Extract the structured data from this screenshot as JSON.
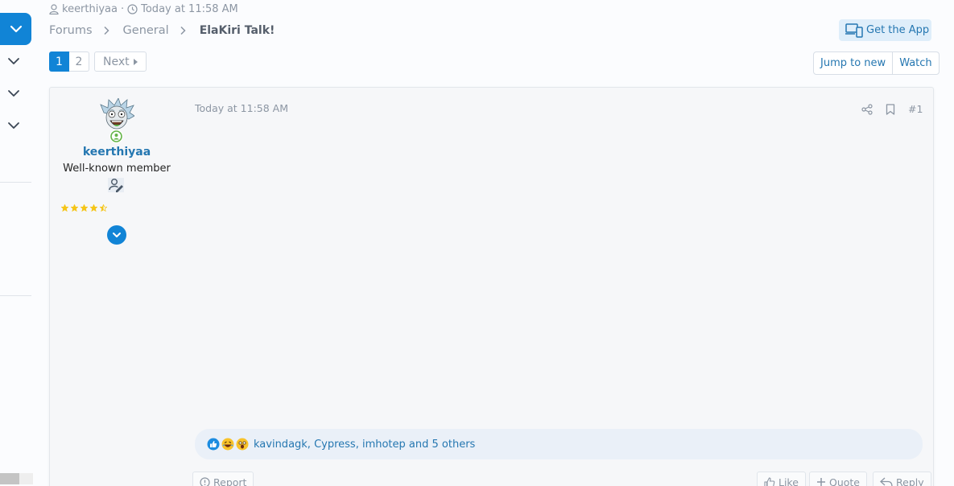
{
  "meta": {
    "author": "keerthiyaa",
    "separator": "·",
    "time": "Today at 11:58 AM"
  },
  "breadcrumb": {
    "items": [
      "Forums",
      "General"
    ],
    "current": "ElaKiri Talk!"
  },
  "header": {
    "get_app_label": "Get the App"
  },
  "pagination": {
    "current": "1",
    "page2": "2",
    "next_label": "Next"
  },
  "thread_actions": {
    "jump_label": "Jump to new",
    "watch_label": "Watch"
  },
  "post": {
    "username": "keerthiyaa",
    "user_title": "Well-known member",
    "rating": 4.5,
    "time": "Today at 11:58 AM",
    "number": "#1",
    "reactions_text": "kavindagk, Cypress, imhotep and 5 others",
    "reaction_icons": [
      "like-icon",
      "laugh-icon",
      "wow-icon"
    ],
    "footer": {
      "report_label": "Report",
      "like_label": "Like",
      "quote_label": "Quote",
      "reply_label": "Reply"
    }
  },
  "colors": {
    "accent": "#1184d6",
    "link": "#2577b1",
    "muted": "#8c96a3",
    "star": "#f5c518"
  }
}
